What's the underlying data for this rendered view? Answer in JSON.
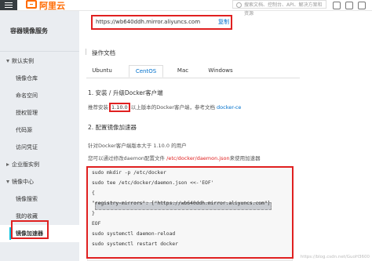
{
  "topbar": {
    "logo_text": "阿里云",
    "search_placeholder": "搜索文档、控制台、API、解决方案和资源"
  },
  "sidebar": {
    "title": "容器镜像服务",
    "groups": [
      {
        "label": "默认实例",
        "items": [
          "镜像仓库",
          "命名空间",
          "授权管理",
          "代码源",
          "访问凭证"
        ]
      },
      {
        "label": "企业版实例",
        "items": []
      },
      {
        "label": "镜像中心",
        "items": [
          "镜像搜索",
          "我的收藏",
          "镜像加速器"
        ]
      }
    ],
    "active_item": "镜像加速器"
  },
  "accelerator": {
    "url": "https://wb640ddh.mirror.aliyuncs.com",
    "copy_label": "复制"
  },
  "docs": {
    "title": "操作文档",
    "tabs": [
      "Ubuntu",
      "CentOS",
      "Mac",
      "Windows"
    ],
    "active_tab": "CentOS",
    "section1_title": "1. 安装 / 升级Docker客户端",
    "section1_pre": "推荐安装",
    "section1_version": "1.10.0",
    "section1_post": "以上版本的Docker客户端，参考文档",
    "section1_link": "docker-ce",
    "section2_title": "2. 配置镜像加速器",
    "section2_line1": "针对Docker客户端版本大于 1.10.0 的用户",
    "section2_line2_pre": "您可以通过修改daemon配置文件",
    "section2_line2_file": "/etc/docker/daemon.json",
    "section2_line2_post": "来使用加速器",
    "code_lines": [
      "sudo mkdir -p /etc/docker",
      "sudo tee /etc/docker/daemon.json <<-'EOF'",
      "{",
      "  \"registry-mirrors\": [\"https://wb640ddh.mirror.aliyuncs.com\"]",
      "}",
      "EOF",
      "sudo systemctl daemon-reload",
      "sudo systemctl restart docker"
    ]
  },
  "watermark": "https://blog.csdn.net/GuoH3600",
  "colors": {
    "brand": "#ff6a00",
    "highlight": "#e02020",
    "link": "#0070cc",
    "accent": "#00c1de"
  }
}
